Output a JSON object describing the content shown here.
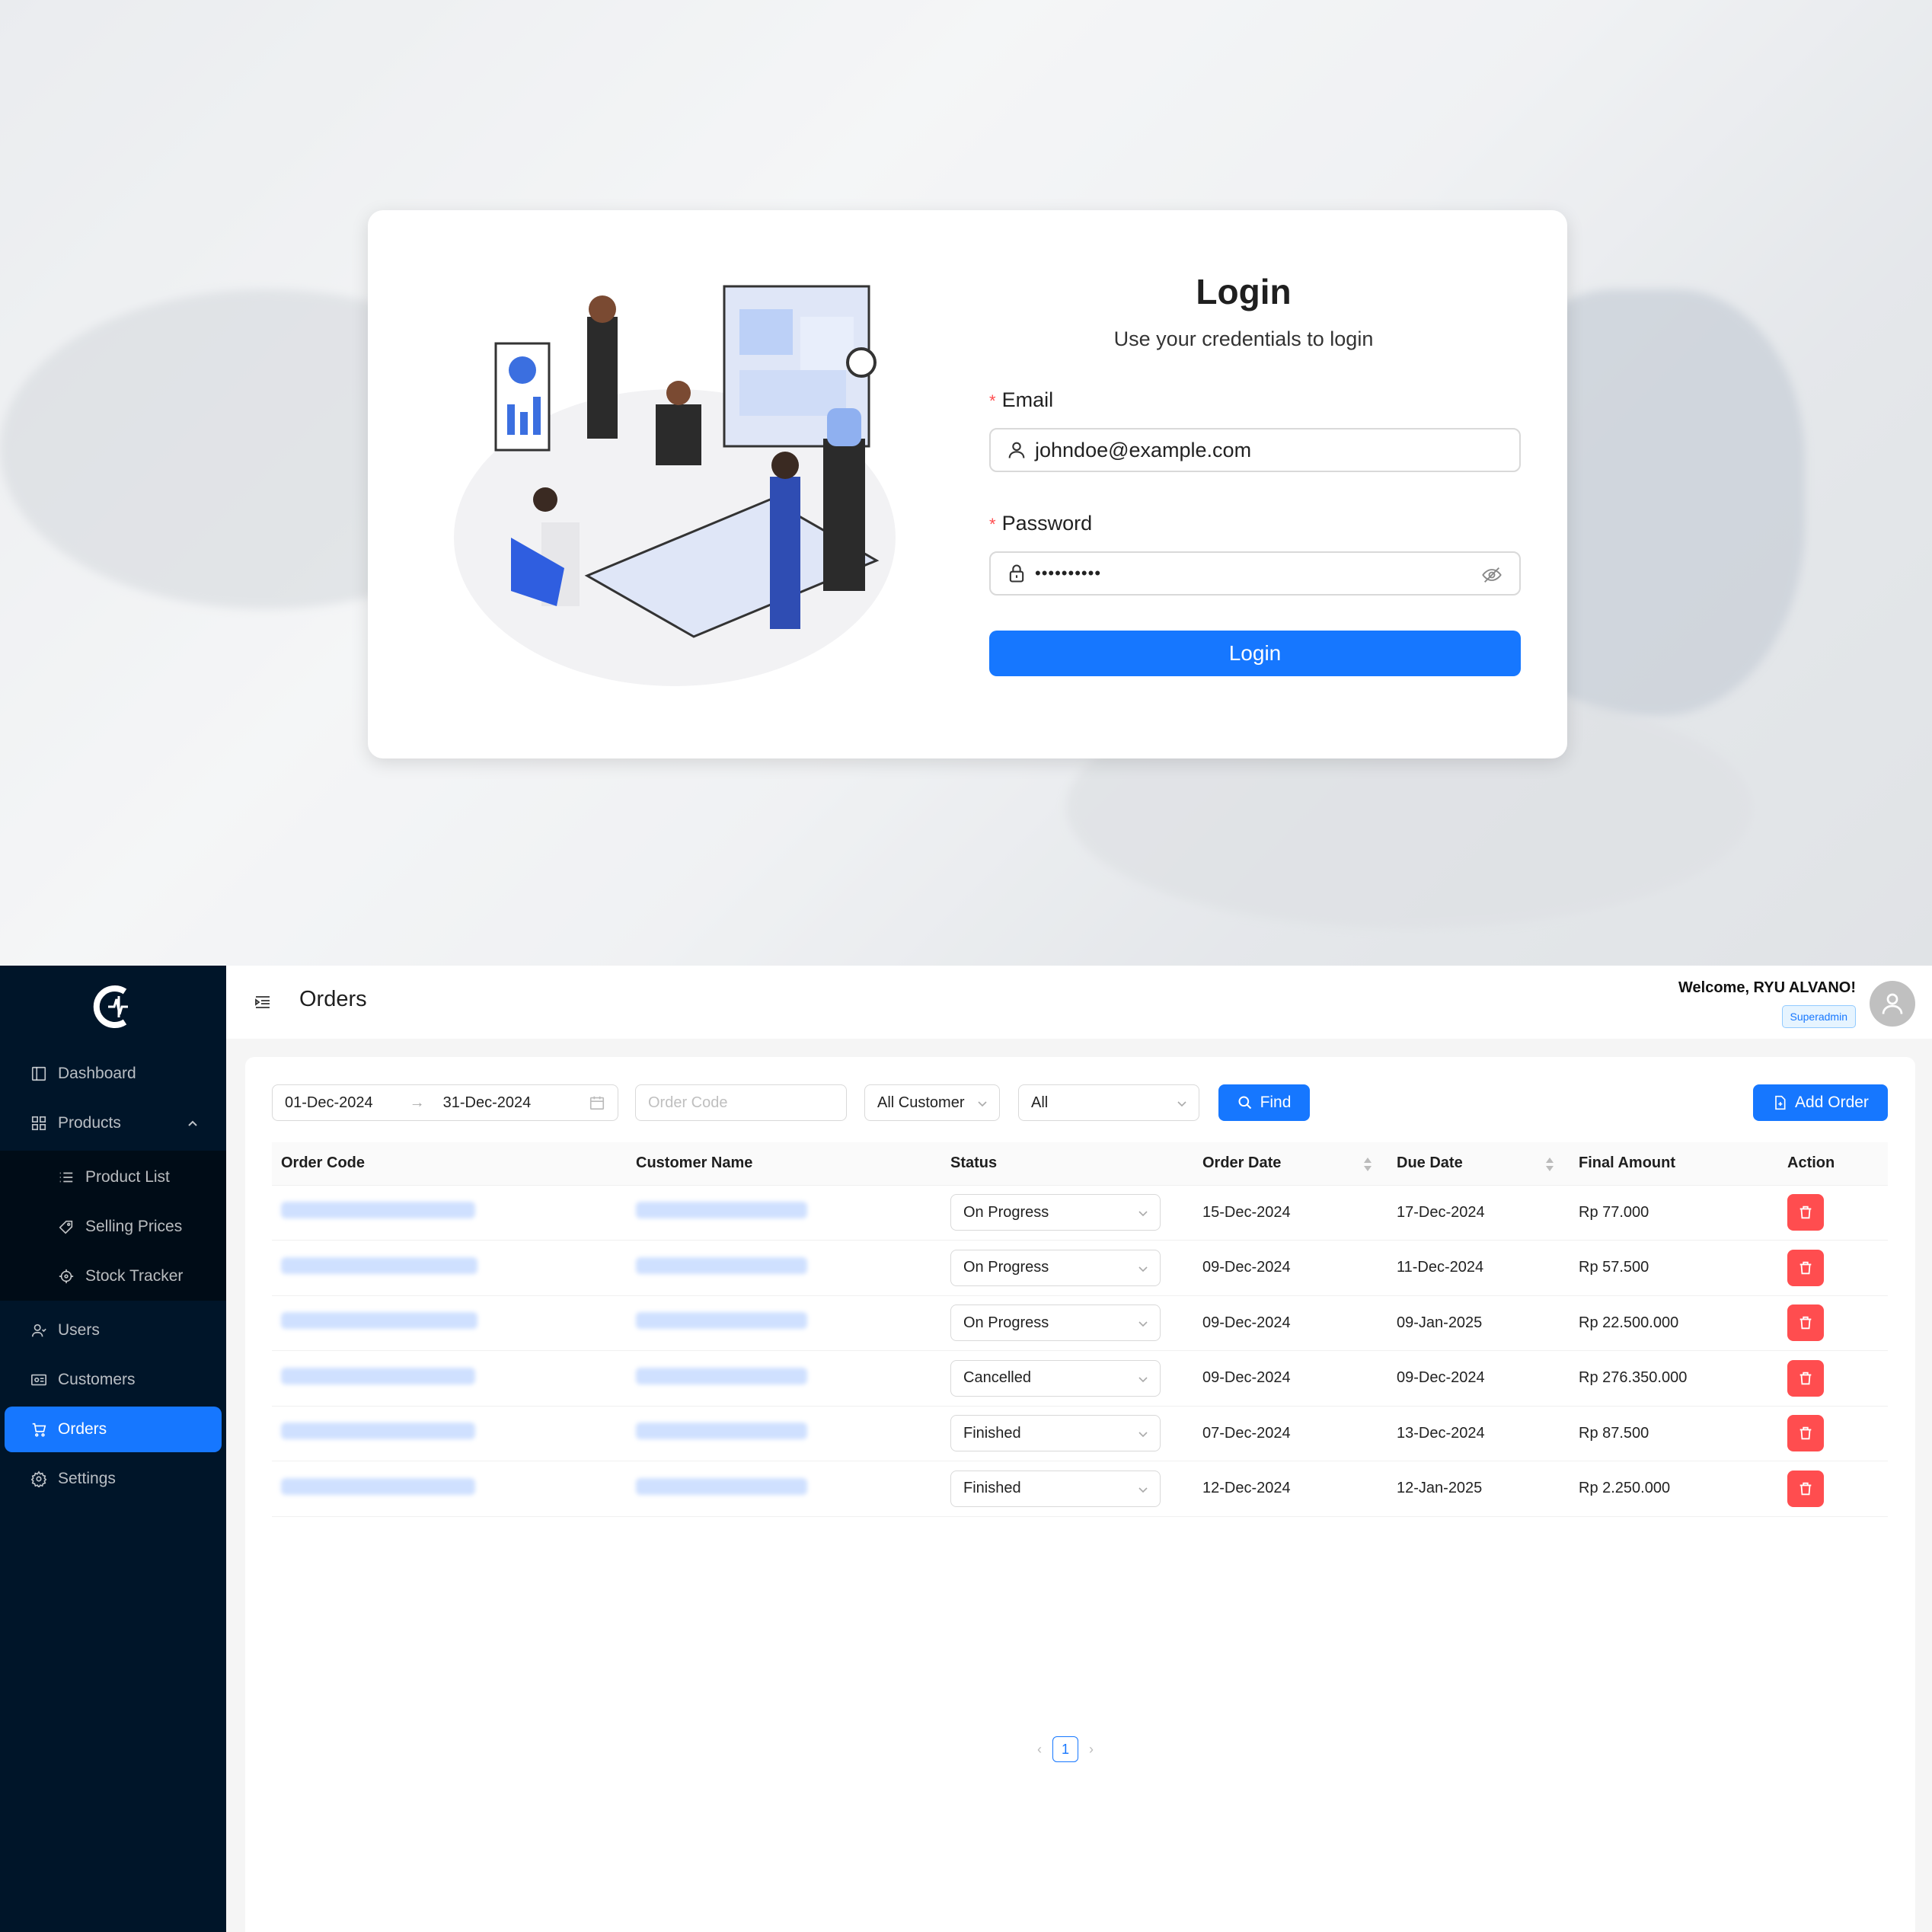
{
  "login": {
    "title": "Login",
    "subtitle": "Use your credentials to login",
    "email_label": "Email",
    "email_value": "johndoe@example.com",
    "password_label": "Password",
    "password_value": "••••••••••",
    "submit_label": "Login"
  },
  "header": {
    "title": "Orders",
    "welcome": "Welcome, RYU ALVANO!",
    "role": "Superadmin"
  },
  "sidebar": {
    "items": [
      {
        "label": "Dashboard",
        "icon": "dashboard-icon"
      },
      {
        "label": "Products",
        "icon": "grid-icon"
      },
      {
        "label": "Product List",
        "icon": "list-icon"
      },
      {
        "label": "Selling Prices",
        "icon": "tag-icon"
      },
      {
        "label": "Stock Tracker",
        "icon": "target-icon"
      },
      {
        "label": "Users",
        "icon": "users-icon"
      },
      {
        "label": "Customers",
        "icon": "id-card-icon"
      },
      {
        "label": "Orders",
        "icon": "cart-icon"
      },
      {
        "label": "Settings",
        "icon": "gear-icon"
      }
    ],
    "active": "Orders"
  },
  "filters": {
    "date_start": "01-Dec-2024",
    "date_end": "31-Dec-2024",
    "order_code_placeholder": "Order Code",
    "customer": "All Customer",
    "status": "All",
    "find_label": "Find",
    "add_label": "Add Order"
  },
  "table": {
    "columns": [
      "Order Code",
      "Customer Name",
      "Status",
      "Order Date",
      "Due Date",
      "Final Amount",
      "Action"
    ],
    "rows": [
      {
        "status": "On Progress",
        "order_date": "15-Dec-2024",
        "due_date": "17-Dec-2024",
        "amount": "Rp 77.000"
      },
      {
        "status": "On Progress",
        "order_date": "09-Dec-2024",
        "due_date": "11-Dec-2024",
        "amount": "Rp 57.500"
      },
      {
        "status": "On Progress",
        "order_date": "09-Dec-2024",
        "due_date": "09-Jan-2025",
        "amount": "Rp 22.500.000"
      },
      {
        "status": "Cancelled",
        "order_date": "09-Dec-2024",
        "due_date": "09-Dec-2024",
        "amount": "Rp 276.350.000"
      },
      {
        "status": "Finished",
        "order_date": "07-Dec-2024",
        "due_date": "13-Dec-2024",
        "amount": "Rp 87.500"
      },
      {
        "status": "Finished",
        "order_date": "12-Dec-2024",
        "due_date": "12-Jan-2025",
        "amount": "Rp 2.250.000"
      }
    ]
  },
  "pagination": {
    "current": "1"
  },
  "colors": {
    "primary": "#1677ff",
    "sidebar": "#001529",
    "danger": "#ff4d4f"
  }
}
